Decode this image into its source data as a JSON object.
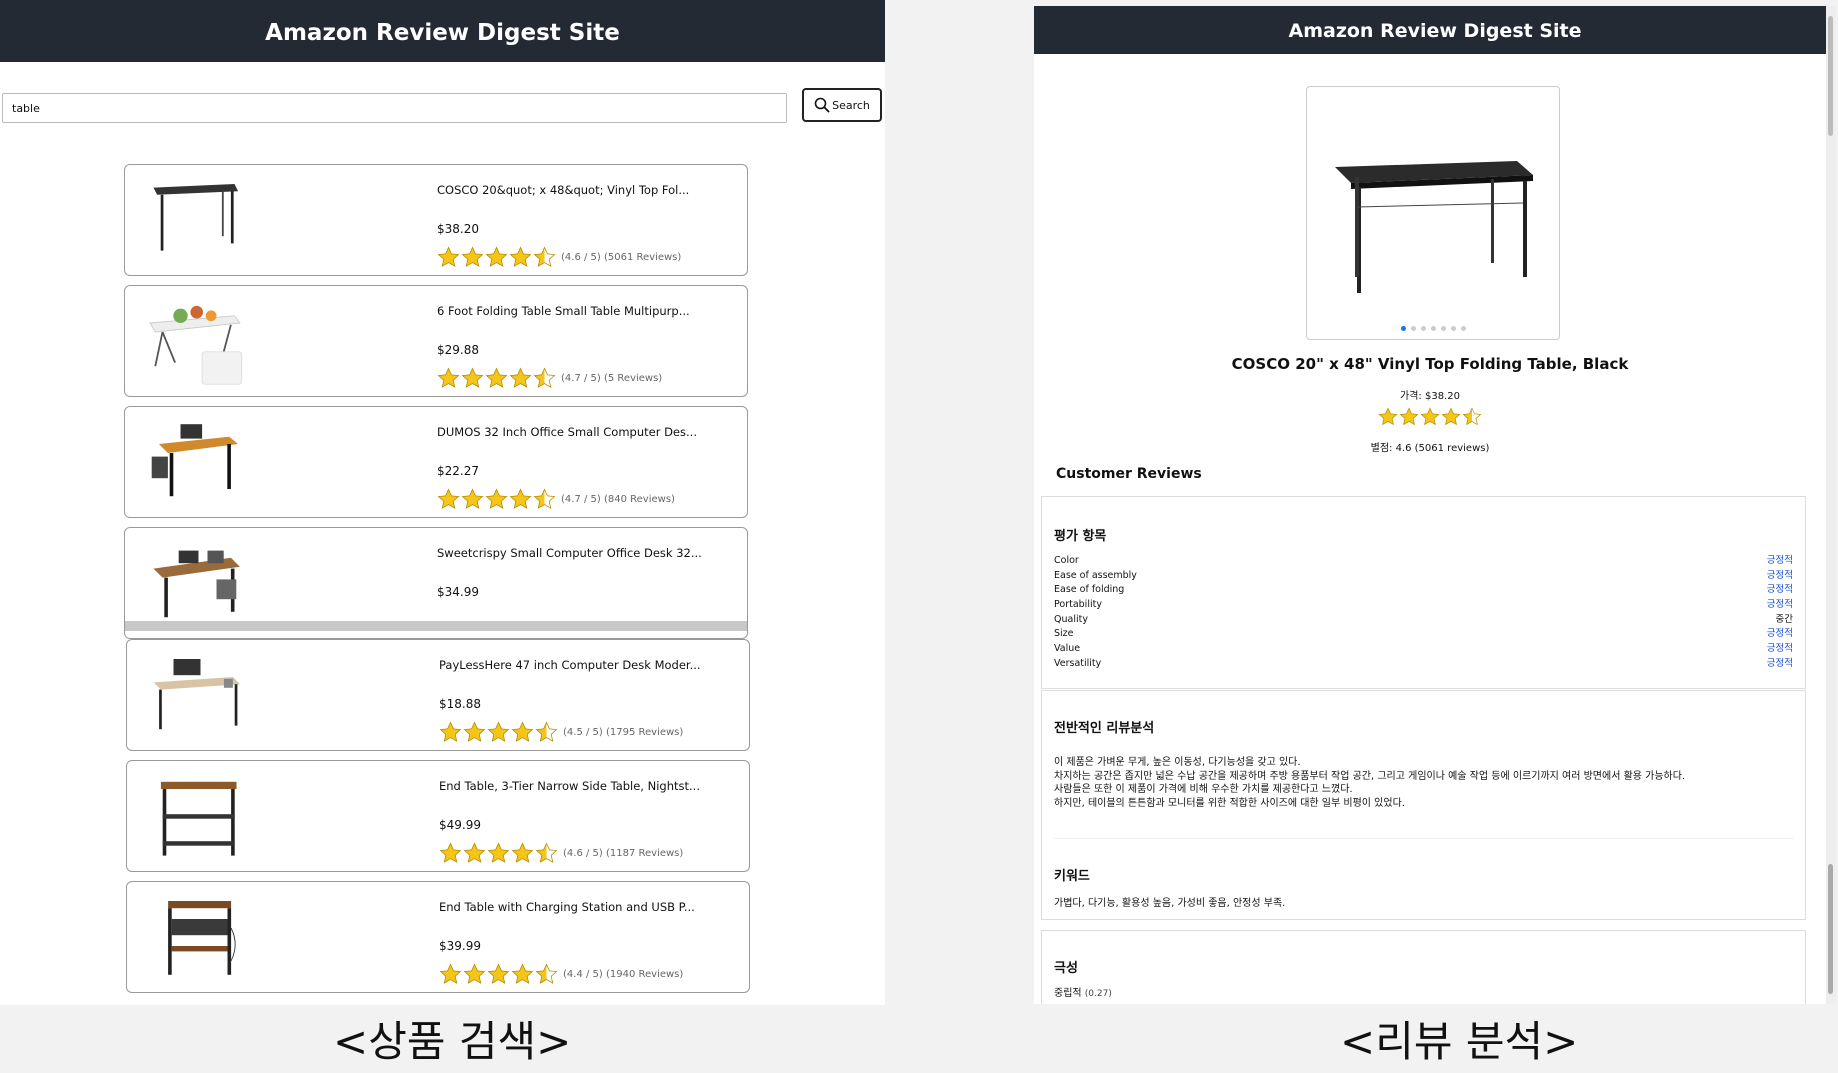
{
  "search_page": {
    "title": "Amazon Review Digest Site",
    "search": {
      "value": "table",
      "button_label": "Search"
    },
    "products": [
      {
        "name": "COSCO 20&quot; x 48&quot; Vinyl Top Fol...",
        "price": "$38.20",
        "rating": 4.6,
        "rating_text": "(4.6 / 5) (5061 Reviews)",
        "thumb": "black-table"
      },
      {
        "name": "6 Foot Folding Table Small Table Multipurp...",
        "price": "$29.88",
        "rating": 4.7,
        "rating_text": "(4.7 / 5) (5 Reviews)",
        "thumb": "white-folding-table"
      },
      {
        "name": "DUMOS 32 Inch Office Small Computer Des...",
        "price": "$22.27",
        "rating": 4.7,
        "rating_text": "(4.7 / 5) (840 Reviews)",
        "thumb": "orange-desk"
      },
      {
        "name": "Sweetcrispy Small Computer Office Desk 32...",
        "price": "$34.99",
        "rating": null,
        "rating_text": "",
        "thumb": "wood-desk"
      },
      {
        "name": "PayLessHere 47 inch Computer Desk Moder...",
        "price": "$18.88",
        "rating": 4.5,
        "rating_text": "(4.5 / 5) (1795 Reviews)",
        "thumb": "light-desk"
      },
      {
        "name": "End Table, 3-Tier Narrow Side Table, Nightst...",
        "price": "$49.99",
        "rating": 4.6,
        "rating_text": "(4.6 / 5) (1187 Reviews)",
        "thumb": "shelf-table"
      },
      {
        "name": "End Table with Charging Station and USB P...",
        "price": "$39.99",
        "rating": 4.4,
        "rating_text": "(4.4 / 5) (1940 Reviews)",
        "thumb": "end-table"
      }
    ],
    "caption": "<상품 검색>"
  },
  "review_page": {
    "title": "Amazon Review Digest Site",
    "product_title": "COSCO 20\" x 48\" Vinyl Top Folding Table, Black",
    "price_text": "가격: $38.20",
    "rating": 4.6,
    "rating_text": "별점: 4.6 (5061 reviews)",
    "gallery_dots": 7,
    "section_title": "Customer Reviews",
    "criteria": {
      "title": "평가 항목",
      "items": [
        {
          "name": "Color",
          "value": "긍정적",
          "tone": "positive"
        },
        {
          "name": "Ease of assembly",
          "value": "긍정적",
          "tone": "positive"
        },
        {
          "name": "Ease of folding",
          "value": "긍정적",
          "tone": "positive"
        },
        {
          "name": "Portability",
          "value": "긍정적",
          "tone": "positive"
        },
        {
          "name": "Quality",
          "value": "중간",
          "tone": "neutral"
        },
        {
          "name": "Size",
          "value": "긍정적",
          "tone": "positive"
        },
        {
          "name": "Value",
          "value": "긍정적",
          "tone": "positive"
        },
        {
          "name": "Versatility",
          "value": "긍정적",
          "tone": "positive"
        }
      ]
    },
    "summary": {
      "title": "전반적인 리뷰분석",
      "lines": [
        "이 제품은 가벼운 무게, 높은 이동성, 다기능성을 갖고 있다.",
        "차지하는 공간은 좁지만 넓은 수납 공간을 제공하며 주방 용품부터 작업 공간, 그리고 게임이나 예술 작업 등에 이르기까지 여러 방면에서 활용 가능하다.",
        "사람들은 또한 이 제품이 가격에 비해 우수한 가치를 제공한다고 느꼈다.",
        "하지만, 테이블의 튼튼함과 모니터를 위한 적합한 사이즈에 대한 일부 비평이 있었다."
      ]
    },
    "keywords": {
      "title": "키워드",
      "text": "가볍다, 다기능, 활용성 높음, 가성비 좋음, 안정성 부족."
    },
    "polarity": {
      "title": "극성",
      "label": "중립적",
      "score": "(0.27)"
    },
    "caption": "<리뷰 분석>"
  },
  "colors": {
    "header": "#232a34",
    "star": "#f5c518",
    "positive": "#1a4fd6",
    "active_dot": "#1a73e8"
  }
}
